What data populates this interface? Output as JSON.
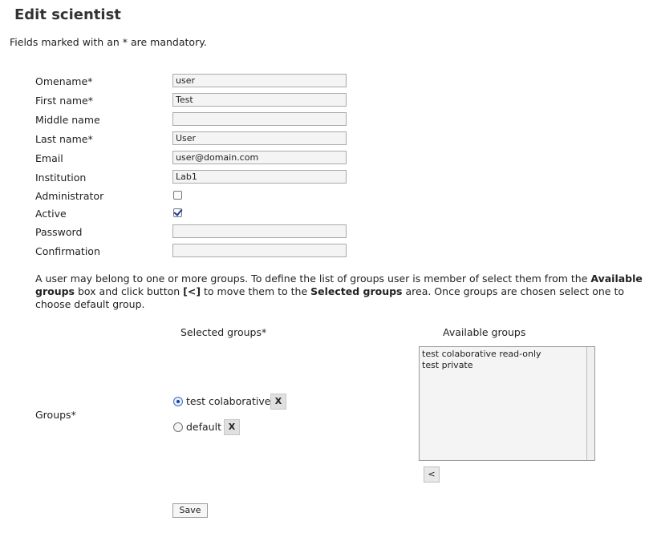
{
  "page": {
    "title": "Edit scientist",
    "mandatory_note": "Fields marked with an * are mandatory."
  },
  "form": {
    "omename": {
      "label": "Omename*",
      "value": "user"
    },
    "first_name": {
      "label": "First name*",
      "value": "Test"
    },
    "middle_name": {
      "label": "Middle name",
      "value": ""
    },
    "last_name": {
      "label": "Last name*",
      "value": "User"
    },
    "email": {
      "label": "Email",
      "value": "user@domain.com"
    },
    "institution": {
      "label": "Institution",
      "value": "Lab1"
    },
    "administrator": {
      "label": "Administrator",
      "checked": false
    },
    "active": {
      "label": "Active",
      "checked": true
    },
    "password": {
      "label": "Password",
      "value": ""
    },
    "confirmation": {
      "label": "Confirmation",
      "value": ""
    }
  },
  "help": {
    "t1": "A user may belong to one or more groups. To define the list of groups user is member of select them from the ",
    "b1": "Available groups",
    "t2": " box and click button ",
    "b2": "[<]",
    "t3": " to move them to the ",
    "b3": "Selected groups",
    "t4": " area. Once groups are chosen select one to choose default group."
  },
  "groups": {
    "label": "Groups*",
    "selected_header": "Selected groups*",
    "available_header": "Available groups",
    "selected": [
      {
        "name": "test colaborative",
        "default": true,
        "remove_label": "X"
      },
      {
        "name": "default",
        "default": false,
        "remove_label": "X"
      }
    ],
    "available": [
      "test colaborative read-only",
      "test private"
    ],
    "move_label": "<"
  },
  "actions": {
    "save_label": "Save"
  }
}
